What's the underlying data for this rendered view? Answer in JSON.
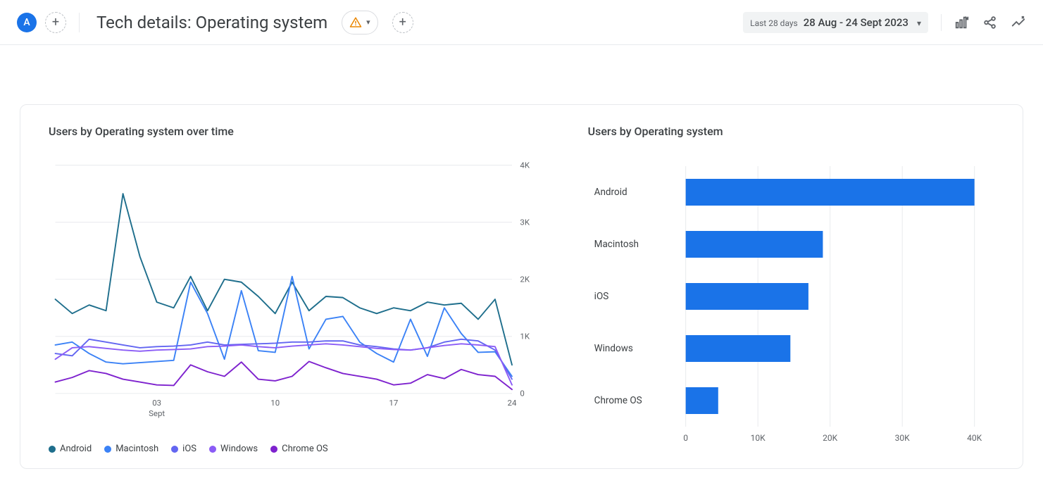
{
  "header": {
    "avatar_letter": "A",
    "title": "Tech details: Operating system",
    "date_prefix": "Last 28 days",
    "date_range": "28 Aug - 24 Sept 2023"
  },
  "chart_data": [
    {
      "type": "line",
      "title": "Users by Operating system over time",
      "ylabel": "",
      "ylim": [
        0,
        4000
      ],
      "y_ticks": [
        0,
        1000,
        2000,
        3000,
        4000
      ],
      "y_tick_labels": [
        "0",
        "1K",
        "2K",
        "3K",
        "4K"
      ],
      "x_dates": [
        "28",
        "29",
        "30",
        "31",
        "01",
        "02",
        "03",
        "04",
        "05",
        "06",
        "07",
        "08",
        "09",
        "10",
        "11",
        "12",
        "13",
        "14",
        "15",
        "16",
        "17",
        "18",
        "19",
        "20",
        "21",
        "22",
        "23",
        "24"
      ],
      "x_tick_index": [
        6,
        13,
        20,
        27
      ],
      "x_tick_labels": [
        "03",
        "10",
        "17",
        "24"
      ],
      "x_sub_label": "Sept",
      "series": [
        {
          "name": "Android",
          "color": "#1e6e8c",
          "values": [
            1650,
            1400,
            1550,
            1450,
            3500,
            2400,
            1600,
            1500,
            2050,
            1450,
            2000,
            1950,
            1700,
            1400,
            1950,
            1450,
            1700,
            1680,
            1500,
            1400,
            1500,
            1450,
            1600,
            1550,
            1580,
            1300,
            1650,
            500
          ]
        },
        {
          "name": "Macintosh",
          "color": "#3b82f6",
          "values": [
            850,
            900,
            700,
            550,
            520,
            540,
            560,
            580,
            1950,
            1400,
            600,
            1800,
            750,
            720,
            2050,
            780,
            1300,
            1350,
            900,
            700,
            550,
            1300,
            650,
            1500,
            1050,
            720,
            730,
            300
          ]
        },
        {
          "name": "iOS",
          "color": "#6366f1",
          "values": [
            700,
            660,
            950,
            900,
            850,
            800,
            820,
            830,
            850,
            900,
            850,
            860,
            870,
            880,
            900,
            900,
            920,
            920,
            850,
            820,
            780,
            760,
            800,
            900,
            950,
            920,
            760,
            250
          ]
        },
        {
          "name": "Windows",
          "color": "#8b5cf6",
          "values": [
            600,
            800,
            820,
            790,
            760,
            740,
            760,
            770,
            780,
            820,
            830,
            850,
            820,
            800,
            830,
            850,
            870,
            850,
            820,
            790,
            770,
            760,
            800,
            840,
            870,
            850,
            820,
            150
          ]
        },
        {
          "name": "Chrome OS",
          "color": "#7e22ce",
          "values": [
            200,
            280,
            400,
            350,
            250,
            200,
            150,
            140,
            500,
            380,
            300,
            550,
            250,
            220,
            300,
            560,
            450,
            350,
            300,
            250,
            150,
            180,
            330,
            260,
            420,
            330,
            300,
            70
          ]
        }
      ]
    },
    {
      "type": "bar",
      "title": "Users by Operating system",
      "xlim": [
        0,
        40000
      ],
      "x_ticks": [
        0,
        10000,
        20000,
        30000,
        40000
      ],
      "x_tick_labels": [
        "0",
        "10K",
        "20K",
        "30K",
        "40K"
      ],
      "categories": [
        "Android",
        "Macintosh",
        "iOS",
        "Windows",
        "Chrome OS"
      ],
      "values": [
        40000,
        19000,
        17000,
        14500,
        4500
      ],
      "color": "#1a73e8"
    }
  ]
}
